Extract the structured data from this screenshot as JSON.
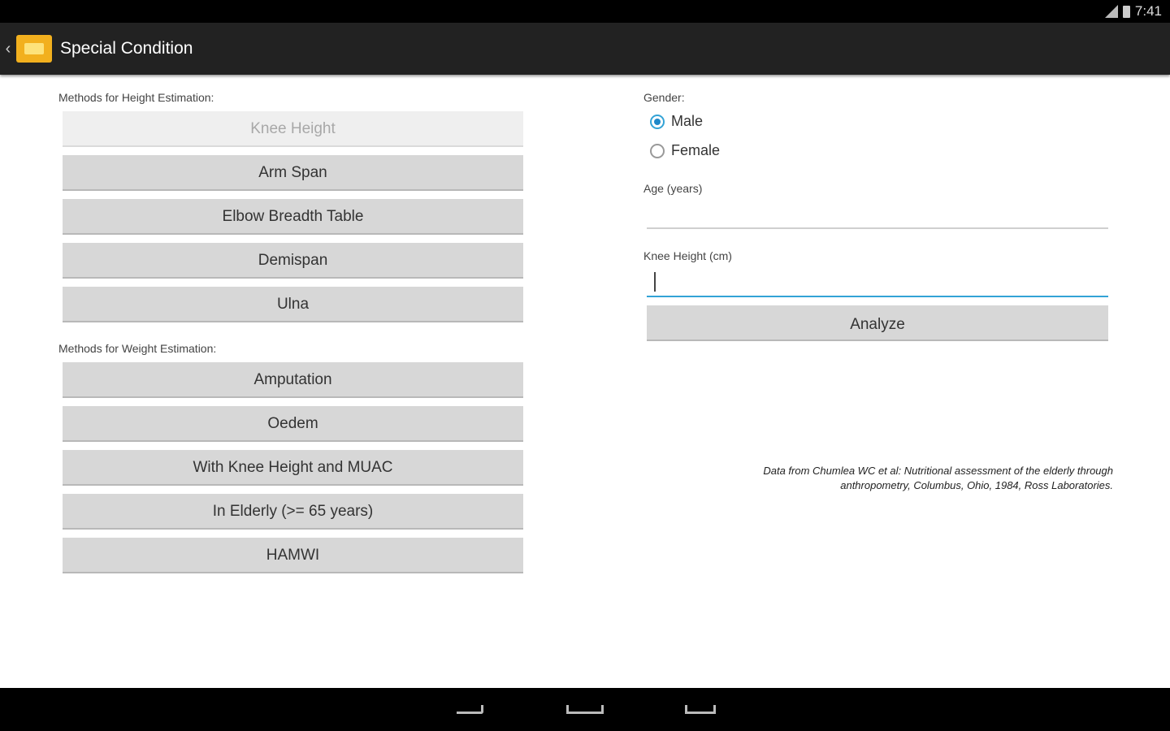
{
  "status": {
    "time": "7:41"
  },
  "actionbar": {
    "back": "‹",
    "title": "Special Condition"
  },
  "height_section": {
    "label": "Methods for Height Estimation:",
    "buttons": [
      "Knee Height",
      "Arm Span",
      "Elbow Breadth Table",
      "Demispan",
      "Ulna"
    ]
  },
  "weight_section": {
    "label": "Methods for Weight Estimation:",
    "buttons": [
      "Amputation",
      "Oedem",
      "With Knee Height and MUAC",
      "In Elderly (>= 65 years)",
      "HAMWI"
    ]
  },
  "form": {
    "gender_label": "Gender:",
    "gender_options": [
      "Male",
      "Female"
    ],
    "gender_selected": "Male",
    "age_label": "Age (years)",
    "age_value": "",
    "knee_label": "Knee Height (cm)",
    "knee_value": "",
    "analyze_label": "Analyze"
  },
  "citation": {
    "line1": "Data from Chumlea WC et al: Nutritional assessment of the elderly through",
    "line2": "anthropometry, Columbus, Ohio, 1984, Ross Laboratories."
  },
  "colors": {
    "accent": "#33a3d6",
    "action_bar": "#222222",
    "button_bg": "#d7d7d7",
    "logo": "#f2b01e"
  }
}
